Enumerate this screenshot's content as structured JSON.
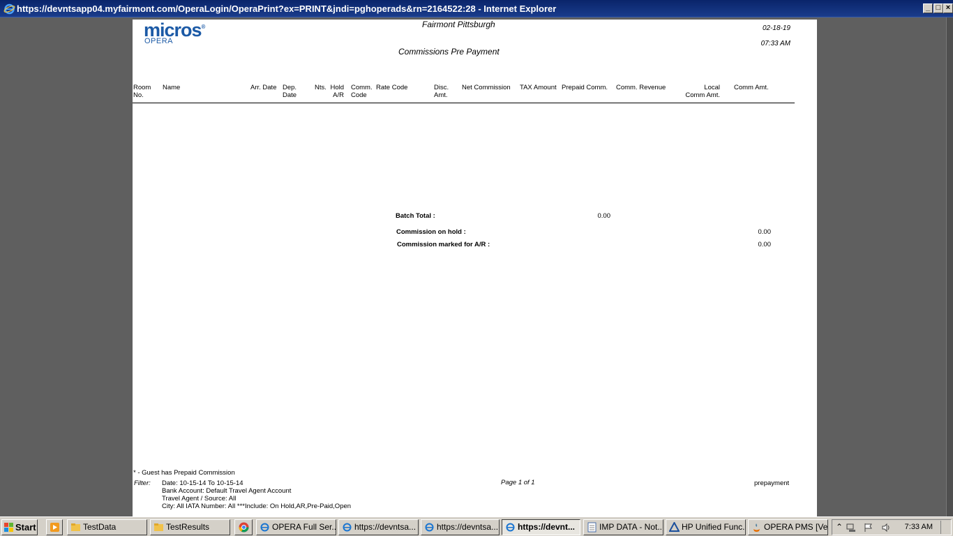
{
  "window": {
    "title": "https://devntsapp04.myfairmont.com/OperaLogin/OperaPrint?ex=PRINT&jndi=pghoperads&rn=2164522:28 - Internet Explorer",
    "minimize": "_",
    "maximize": "□",
    "close": "×"
  },
  "report": {
    "logo_text": "micros",
    "logo_sub": "OPERA",
    "hotel": "Fairmont Pittsburgh",
    "title": "Commissions Pre Payment",
    "date": "02-18-19",
    "time": "07:33 AM",
    "columns": {
      "room": [
        "Room",
        "No."
      ],
      "name": "Name",
      "arr": "Arr. Date",
      "dep": [
        "Dep.",
        "Date"
      ],
      "nts": "Nts.",
      "hold": [
        "Hold",
        "A/R"
      ],
      "comm_code": [
        "Comm.",
        "Code"
      ],
      "rate_code": "Rate Code",
      "disc": [
        "Disc.",
        "Amt."
      ],
      "net": "Net Commission",
      "tax": "TAX Amount",
      "prepaid": "Prepaid Comm.",
      "revenue": "Comm. Revenue",
      "local": [
        "Local",
        "Comm Amt."
      ],
      "comm_amt": "Comm Amt."
    },
    "totals": {
      "batch_label": "Batch Total :",
      "batch_value": "0.00",
      "hold_label": "Commission on hold :",
      "hold_value": "0.00",
      "ar_label": "Commission marked for A/R :",
      "ar_value": "0.00"
    },
    "footer": {
      "note": "* - Guest has Prepaid Commission",
      "filter_label": "Filter:",
      "filter_lines": [
        "Date: 10-15-14 To 10-15-14",
        "Bank Account: Default Travel Agent Account",
        "Travel Agent / Source: All",
        "City: All IATA Number: All ***Include: On Hold,AR,Pre-Paid,Open"
      ],
      "page": "Page 1 of  1",
      "report_name": "prepayment"
    }
  },
  "taskbar": {
    "start": "Start",
    "items": [
      {
        "label": "TestData",
        "icon": "folder-icon"
      },
      {
        "label": "TestResults",
        "icon": "folder-icon"
      },
      {
        "label": "OPERA Full Ser...",
        "icon": "ie-icon"
      },
      {
        "label": "https://devntsa...",
        "icon": "ie-icon"
      },
      {
        "label": "https://devntsa...",
        "icon": "ie-icon"
      },
      {
        "label": "https://devnt...",
        "icon": "ie-icon"
      },
      {
        "label": "IMP DATA - Not...",
        "icon": "notepad-icon"
      },
      {
        "label": "HP Unified Func...",
        "icon": "hp-icon"
      },
      {
        "label": "OPERA PMS [Ve...",
        "icon": "java-icon"
      }
    ],
    "clock": "7:33 AM"
  }
}
